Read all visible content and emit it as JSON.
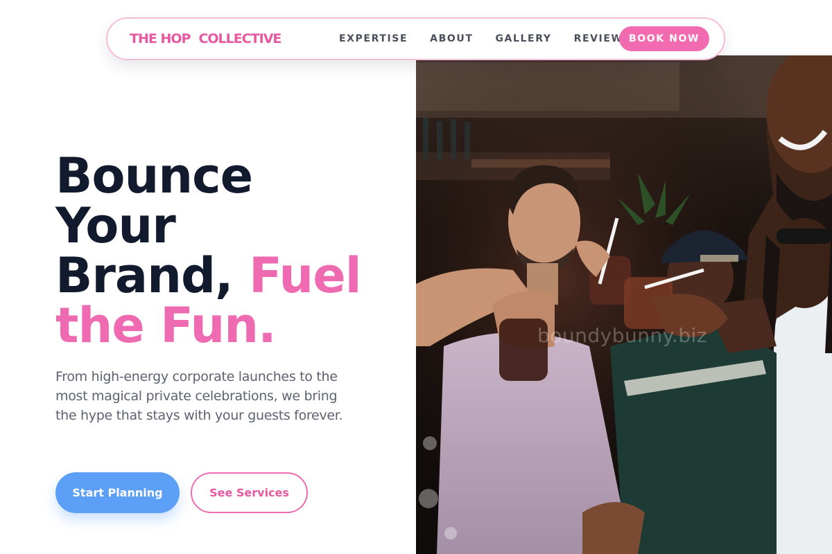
{
  "nav": {
    "brand_part1": "THE HOP",
    "brand_part2": "COLLECTIVE",
    "links": [
      "EXPERTISE",
      "ABOUT",
      "GALLERY",
      "REVIEWS"
    ],
    "cta": "BOOK NOW"
  },
  "hero": {
    "title_line1": "Bounce",
    "title_line2": "Your",
    "title_line3_dark": "Brand,",
    "title_line3_pink": "Fuel",
    "title_line4_pink": "the Fun.",
    "description": "From high-energy corporate launches to the most magical private celebrations, we bring the hype that stays with your guests forever.",
    "primary_button": "Start Planning",
    "secondary_button": "See Services",
    "photo_watermark": "boundybunny.biz"
  },
  "colors": {
    "brand_pink": "#ee6bb2",
    "primary_blue": "#5b9ff7",
    "heading_dark": "#121a2e",
    "body_gray": "#5b6270"
  }
}
